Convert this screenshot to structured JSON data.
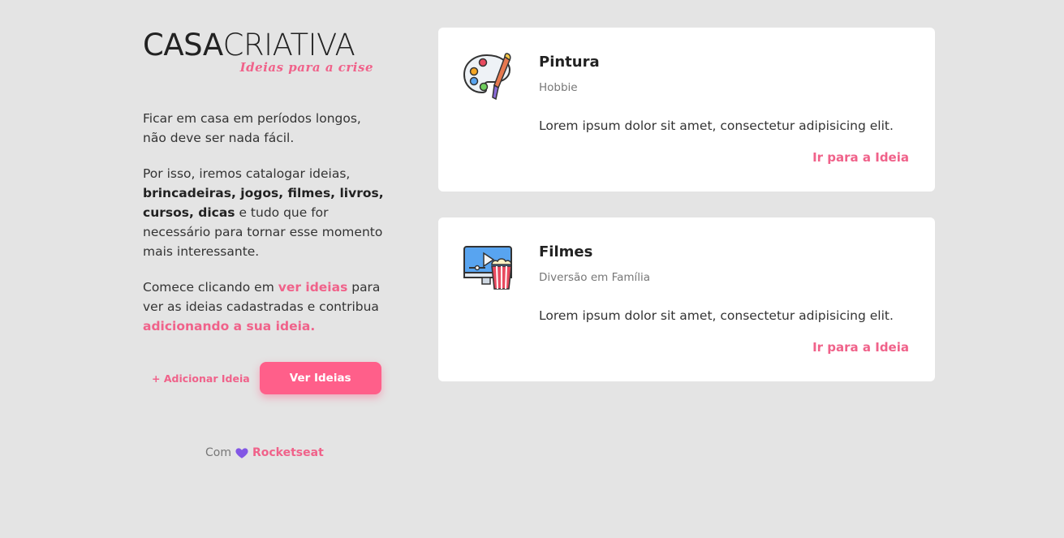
{
  "brand": {
    "logo_light": "CASA",
    "logo_bold": "CRIATIVA",
    "tagline": "Ideias para a crise"
  },
  "intro": {
    "p1": "Ficar em casa em períodos longos, não deve ser nada fácil.",
    "p2_start": "Por isso, iremos catalogar ideias, ",
    "p2_bold": "brincadeiras, jogos, filmes, livros, cursos, dicas",
    "p2_end": " e tudo que for necessário para tornar esse momento mais interessante.",
    "p3_start": "Comece clicando em ",
    "p3_link": "ver ideias",
    "p3_mid": " para ver as ideias cadastradas e contribua ",
    "p3_link2": "adicionando a sua ideia."
  },
  "actions": {
    "add_label": "+ Adicionar Ideia",
    "view_label": "Ver Ideias"
  },
  "footer": {
    "prefix": "Com",
    "brand": "Rocketseat"
  },
  "ideas": [
    {
      "title": "Pintura",
      "category": "Hobbie",
      "description": "Lorem ipsum dolor sit amet, consectetur adipisicing elit.",
      "link": "Ir para a Ideia",
      "icon": "palette-icon"
    },
    {
      "title": "Filmes",
      "category": "Diversão em Família",
      "description": "Lorem ipsum dolor sit amet, consectetur adipisicing elit.",
      "link": "Ir para a Ideia",
      "icon": "movie-popcorn-icon"
    }
  ],
  "colors": {
    "accent": "#f0628a",
    "button": "#ff5f8a",
    "background": "#e4e4e4",
    "card": "#ffffff"
  }
}
